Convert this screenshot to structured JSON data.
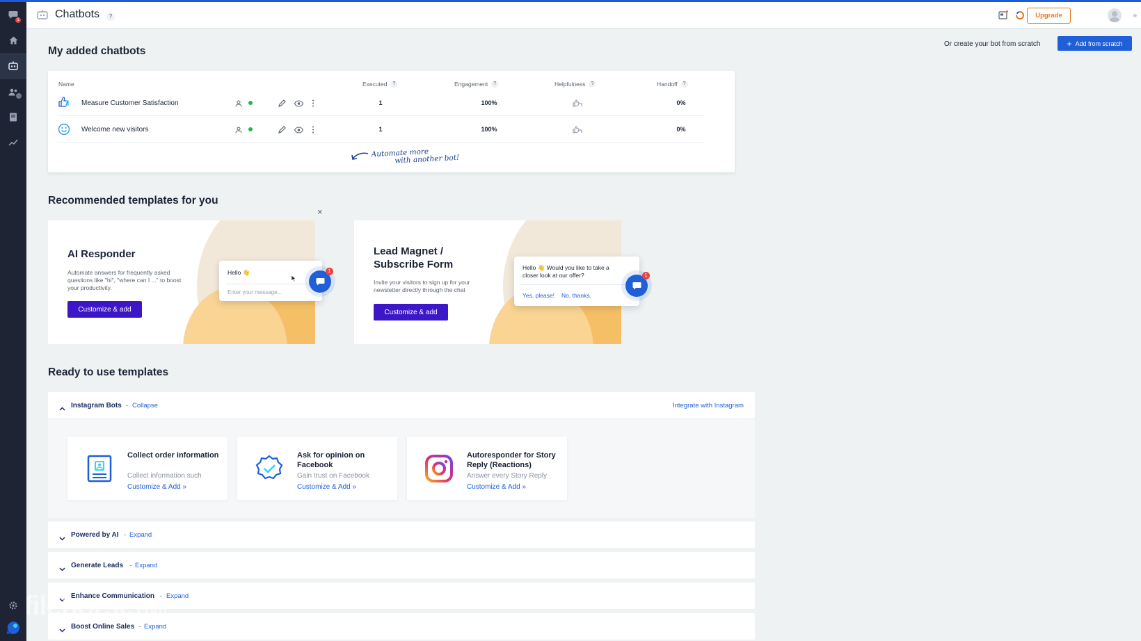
{
  "colors": {
    "accent": "#1f5fd8",
    "brand_purple": "#3c16c7",
    "upgrade": "#e8771c",
    "rail": "#1e2434",
    "success": "#2bb24c"
  },
  "rail": {
    "icons": [
      "chat-icon",
      "home-icon",
      "chatbot-icon",
      "contacts-icon",
      "book-icon",
      "analytics-icon",
      "settings-icon",
      "brand-logo-icon"
    ],
    "chat_badge": "1"
  },
  "header": {
    "title": "Chatbots",
    "help": "?",
    "upgrade_label": "Upgrade"
  },
  "my_bots": {
    "heading": "My added chatbots",
    "scratch_text": "Or create your bot from scratch",
    "add_button": "Add from scratch",
    "add_plus": "+",
    "columns": {
      "name": "Name",
      "executed": "Executed",
      "engagement": "Engagement",
      "helpfulness": "Helpfulness",
      "handoff": "Handoff"
    },
    "q": "?",
    "rows": [
      {
        "name": "Measure Customer Satisfaction",
        "executed": "1",
        "engagement": "100%",
        "handoff": "0%"
      },
      {
        "name": "Welcome new visitors",
        "executed": "1",
        "engagement": "100%",
        "handoff": "0%"
      }
    ],
    "hint_line1": "Automate more",
    "hint_line2": "with another bot!"
  },
  "recommended": {
    "heading": "Recommended templates for you",
    "close": "×",
    "cards": [
      {
        "title": "AI Responder",
        "desc": "Automate answers for frequently asked questions like \"hi\", \"where can I ...\" to boost your productivity.",
        "button": "Customize & add",
        "bubble_text": "Hello 👋",
        "bubble_placeholder": "Enter your message...",
        "badge": "1"
      },
      {
        "title_line1": "Lead Magnet /",
        "title_line2": "Subscribe Form",
        "desc": "Invite your visitors to sign up for your newsletter directly through the chat",
        "button": "Customize & add",
        "bubble_text": "Hello 👋 Would you like to take a closer look at our offer?",
        "yes": "Yes, please!",
        "no": "No, thanks.",
        "badge": "1"
      }
    ]
  },
  "ready": {
    "heading": "Ready to use templates",
    "instagram": {
      "label": "Instagram Bots",
      "dash": "-",
      "action": "Collapse",
      "integrate": "Integrate with Instagram",
      "cards": [
        {
          "title": "Collect order information",
          "desc": "Collect information such",
          "link": "Customize & Add »"
        },
        {
          "title": "Ask for opinion on Facebook",
          "desc": "Gain trust on Facebook",
          "link": "Customize & Add »"
        },
        {
          "title": "Autoresponder for Story Reply (Reactions)",
          "desc": "Answer every Story Reply",
          "link": "Customize & Add »"
        }
      ]
    },
    "groups": [
      {
        "label": "Powered by AI",
        "dash": "-",
        "action": "Expand"
      },
      {
        "label": "Generate Leads",
        "dash": "-",
        "action": "Expand"
      },
      {
        "label": "Enhance Communication",
        "dash": "-",
        "action": "Expand"
      },
      {
        "label": "Boost Online Sales",
        "dash": "-",
        "action": "Expand"
      }
    ]
  },
  "watermark": {
    "main": "filehorse",
    "suffix": ".com"
  }
}
